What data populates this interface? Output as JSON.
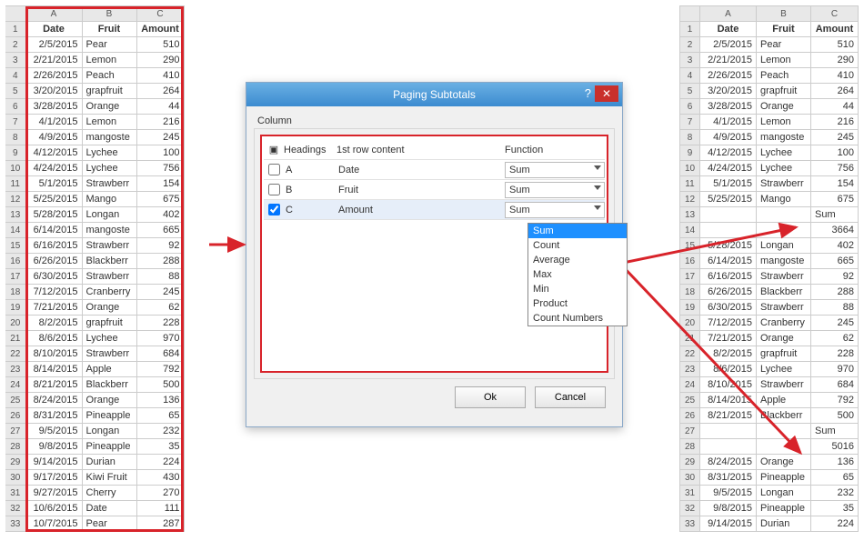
{
  "left": {
    "colheads": [
      "A",
      "B",
      "C"
    ],
    "headers": [
      "Date",
      "Fruit",
      "Amount"
    ],
    "rows": [
      [
        "2/5/2015",
        "Pear",
        "510"
      ],
      [
        "2/21/2015",
        "Lemon",
        "290"
      ],
      [
        "2/26/2015",
        "Peach",
        "410"
      ],
      [
        "3/20/2015",
        "grapfruit",
        "264"
      ],
      [
        "3/28/2015",
        "Orange",
        "44"
      ],
      [
        "4/1/2015",
        "Lemon",
        "216"
      ],
      [
        "4/9/2015",
        "mangoste",
        "245"
      ],
      [
        "4/12/2015",
        "Lychee",
        "100"
      ],
      [
        "4/24/2015",
        "Lychee",
        "756"
      ],
      [
        "5/1/2015",
        "Strawberr",
        "154"
      ],
      [
        "5/25/2015",
        "Mango",
        "675"
      ],
      [
        "5/28/2015",
        "Longan",
        "402"
      ],
      [
        "6/14/2015",
        "mangoste",
        "665"
      ],
      [
        "6/16/2015",
        "Strawberr",
        "92"
      ],
      [
        "6/26/2015",
        "Blackberr",
        "288"
      ],
      [
        "6/30/2015",
        "Strawberr",
        "88"
      ],
      [
        "7/12/2015",
        "Cranberry",
        "245"
      ],
      [
        "7/21/2015",
        "Orange",
        "62"
      ],
      [
        "8/2/2015",
        "grapfruit",
        "228"
      ],
      [
        "8/6/2015",
        "Lychee",
        "970"
      ],
      [
        "8/10/2015",
        "Strawberr",
        "684"
      ],
      [
        "8/14/2015",
        "Apple",
        "792"
      ],
      [
        "8/21/2015",
        "Blackberr",
        "500"
      ],
      [
        "8/24/2015",
        "Orange",
        "136"
      ],
      [
        "8/31/2015",
        "Pineapple",
        "65"
      ],
      [
        "9/5/2015",
        "Longan",
        "232"
      ],
      [
        "9/8/2015",
        "Pineapple",
        "35"
      ],
      [
        "9/14/2015",
        "Durian",
        "224"
      ],
      [
        "9/17/2015",
        "Kiwi Fruit",
        "430"
      ],
      [
        "9/27/2015",
        "Cherry",
        "270"
      ],
      [
        "10/6/2015",
        "Date",
        "111"
      ],
      [
        "10/7/2015",
        "Pear",
        "287"
      ]
    ]
  },
  "right": {
    "colheads": [
      "A",
      "B",
      "C"
    ],
    "headers": [
      "Date",
      "Fruit",
      "Amount"
    ],
    "rows": [
      {
        "n": 2,
        "d": "2/5/2015",
        "f": "Pear",
        "a": "510"
      },
      {
        "n": 3,
        "d": "2/21/2015",
        "f": "Lemon",
        "a": "290"
      },
      {
        "n": 4,
        "d": "2/26/2015",
        "f": "Peach",
        "a": "410"
      },
      {
        "n": 5,
        "d": "3/20/2015",
        "f": "grapfruit",
        "a": "264"
      },
      {
        "n": 6,
        "d": "3/28/2015",
        "f": "Orange",
        "a": "44"
      },
      {
        "n": 7,
        "d": "4/1/2015",
        "f": "Lemon",
        "a": "216"
      },
      {
        "n": 8,
        "d": "4/9/2015",
        "f": "mangoste",
        "a": "245"
      },
      {
        "n": 9,
        "d": "4/12/2015",
        "f": "Lychee",
        "a": "100"
      },
      {
        "n": 10,
        "d": "4/24/2015",
        "f": "Lychee",
        "a": "756"
      },
      {
        "n": 11,
        "d": "5/1/2015",
        "f": "Strawberr",
        "a": "154"
      },
      {
        "n": 12,
        "d": "5/25/2015",
        "f": "Mango",
        "a": "675"
      },
      {
        "n": 13,
        "d": "",
        "f": "",
        "a": "Sum",
        "sub": true
      },
      {
        "n": 14,
        "d": "",
        "f": "",
        "a": "3664",
        "sub": true
      },
      {
        "n": 15,
        "d": "5/28/2015",
        "f": "Longan",
        "a": "402"
      },
      {
        "n": 16,
        "d": "6/14/2015",
        "f": "mangoste",
        "a": "665"
      },
      {
        "n": 17,
        "d": "6/16/2015",
        "f": "Strawberr",
        "a": "92"
      },
      {
        "n": 18,
        "d": "6/26/2015",
        "f": "Blackberr",
        "a": "288"
      },
      {
        "n": 19,
        "d": "6/30/2015",
        "f": "Strawberr",
        "a": "88"
      },
      {
        "n": 20,
        "d": "7/12/2015",
        "f": "Cranberry",
        "a": "245"
      },
      {
        "n": 21,
        "d": "7/21/2015",
        "f": "Orange",
        "a": "62"
      },
      {
        "n": 22,
        "d": "8/2/2015",
        "f": "grapfruit",
        "a": "228"
      },
      {
        "n": 23,
        "d": "8/6/2015",
        "f": "Lychee",
        "a": "970"
      },
      {
        "n": 24,
        "d": "8/10/2015",
        "f": "Strawberr",
        "a": "684"
      },
      {
        "n": 25,
        "d": "8/14/2015",
        "f": "Apple",
        "a": "792"
      },
      {
        "n": 26,
        "d": "8/21/2015",
        "f": "Blackberr",
        "a": "500"
      },
      {
        "n": 27,
        "d": "",
        "f": "",
        "a": "Sum",
        "sub": true
      },
      {
        "n": 28,
        "d": "",
        "f": "",
        "a": "5016",
        "sub": true
      },
      {
        "n": 29,
        "d": "8/24/2015",
        "f": "Orange",
        "a": "136"
      },
      {
        "n": 30,
        "d": "8/31/2015",
        "f": "Pineapple",
        "a": "65"
      },
      {
        "n": 31,
        "d": "9/5/2015",
        "f": "Longan",
        "a": "232"
      },
      {
        "n": 32,
        "d": "9/8/2015",
        "f": "Pineapple",
        "a": "35"
      },
      {
        "n": 33,
        "d": "9/14/2015",
        "f": "Durian",
        "a": "224"
      }
    ]
  },
  "dialog": {
    "title": "Paging Subtotals",
    "group": "Column",
    "headings_label": "Headings",
    "firstrow_label": "1st row content",
    "function_label": "Function",
    "rows": [
      {
        "checked": false,
        "letter": "A",
        "content": "Date",
        "func": "Sum"
      },
      {
        "checked": false,
        "letter": "B",
        "content": "Fruit",
        "func": "Sum"
      },
      {
        "checked": true,
        "letter": "C",
        "content": "Amount",
        "func": "Sum"
      }
    ],
    "dropdown_options": [
      "Sum",
      "Count",
      "Average",
      "Max",
      "Min",
      "Product",
      "Count Numbers"
    ],
    "ok": "Ok",
    "cancel": "Cancel"
  },
  "col_widths": {
    "left_date": 62,
    "left_fruit": 60,
    "left_amount": 52,
    "right_date": 62,
    "right_fruit": 60,
    "right_amount": 52
  }
}
